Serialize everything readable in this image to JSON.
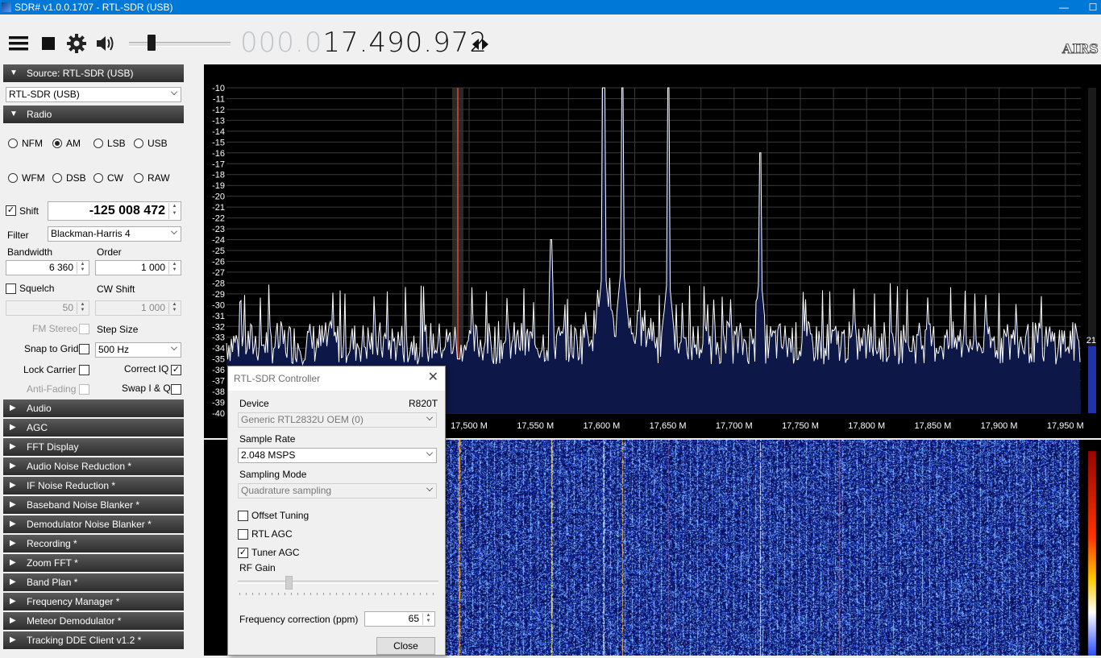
{
  "window": {
    "title": "SDR# v1.0.0.1707 - RTL-SDR (USB)",
    "minimize": "—",
    "maximize": "☐"
  },
  "toolbar": {
    "freq_dim": "000.0",
    "freq_lit": "17.490.972",
    "logo": "AIRS",
    "icons": [
      "menu-icon",
      "stop-icon",
      "gear-icon",
      "speaker-icon"
    ],
    "volume_level": 0.2
  },
  "source": {
    "header": "Source: RTL-SDR (USB)",
    "selected": "RTL-SDR (USB)"
  },
  "radio": {
    "header": "Radio",
    "modes_row1": [
      "NFM",
      "AM",
      "LSB",
      "USB"
    ],
    "modes_row2": [
      "WFM",
      "DSB",
      "CW",
      "RAW"
    ],
    "selected_mode": "AM",
    "shift_label": "Shift",
    "shift_checked": true,
    "shift_value": "-125 008 472",
    "filter_label": "Filter",
    "filter_value": "Blackman-Harris 4",
    "bandwidth_label": "Bandwidth",
    "bandwidth_value": "6 360",
    "order_label": "Order",
    "order_value": "1 000",
    "squelch_label": "Squelch",
    "squelch_value": "50",
    "cwshift_label": "CW Shift",
    "cwshift_value": "1 000",
    "fmstereo_label": "FM Stereo",
    "stepsize_label": "Step Size",
    "stepsize_value": "500 Hz",
    "snap_label": "Snap to Grid",
    "lockcarrier_label": "Lock Carrier",
    "correctiq_label": "Correct IQ",
    "correctiq_checked": true,
    "antifading_label": "Anti-Fading",
    "swapiq_label": "Swap I & Q"
  },
  "panels": [
    "Audio",
    "AGC",
    "FFT Display",
    "Audio Noise Reduction *",
    "IF Noise Reduction *",
    "Baseband Noise Blanker *",
    "Demodulator Noise Blanker *",
    "Recording *",
    "Zoom FFT *",
    "Band Plan *",
    "Frequency Manager *",
    "Meteor Demodulator *",
    "Tracking DDE Client v1.2 *"
  ],
  "spectrum": {
    "y_ticks": [
      "-10",
      "-11",
      "-12",
      "-13",
      "-14",
      "-15",
      "-16",
      "-17",
      "-18",
      "-19",
      "-20",
      "-21",
      "-22",
      "-23",
      "-24",
      "-25",
      "-26",
      "-27",
      "-28",
      "-29",
      "-30",
      "-31",
      "-32",
      "-33",
      "-34",
      "-35",
      "-36",
      "-37",
      "-38",
      "-39",
      "-40"
    ],
    "x_ticks": [
      "17,500 M",
      "17,550 M",
      "17,600 M",
      "17,650 M",
      "17,700 M",
      "17,750 M",
      "17,800 M",
      "17,850 M",
      "17,900 M",
      "17,950 M"
    ],
    "side_value": "21",
    "colors": {
      "fill": "#0d1848",
      "trace": "#ffffff",
      "grid": "#3a3a3a",
      "marker": "#c0392b"
    }
  },
  "dialog": {
    "title": "RTL-SDR Controller",
    "device_label": "Device",
    "tuner": "R820T",
    "device_value": "Generic RTL2832U OEM (0)",
    "samplerate_label": "Sample Rate",
    "samplerate_value": "2.048 MSPS",
    "samplingmode_label": "Sampling Mode",
    "samplingmode_value": "Quadrature sampling",
    "offset_label": "Offset Tuning",
    "rtlagc_label": "RTL AGC",
    "tuneragc_label": "Tuner AGC",
    "rfgain_label": "RF Gain",
    "freqcorr_label": "Frequency correction (ppm)",
    "freqcorr_value": "65",
    "close_label": "Close"
  }
}
